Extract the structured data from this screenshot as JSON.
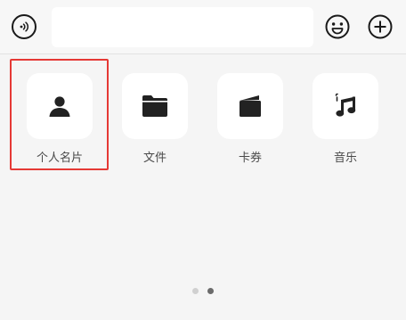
{
  "input_bar": {
    "voice_icon": "voice-input-icon",
    "text_value": "",
    "emoji_icon": "emoji-icon",
    "more_icon": "plus-icon"
  },
  "panel": {
    "items": [
      {
        "label": "个人名片",
        "icon": "contact-card-icon",
        "selected": true
      },
      {
        "label": "文件",
        "icon": "folder-icon",
        "selected": false
      },
      {
        "label": "卡券",
        "icon": "wallet-icon",
        "selected": false
      },
      {
        "label": "音乐",
        "icon": "music-icon",
        "selected": false
      }
    ],
    "page_indicator": {
      "pages": 2,
      "current": 2
    }
  },
  "colors": {
    "highlight": "#e53935",
    "icon": "#222222",
    "dot_inactive": "#d0d0d0",
    "dot_active": "#6b6b6b"
  }
}
